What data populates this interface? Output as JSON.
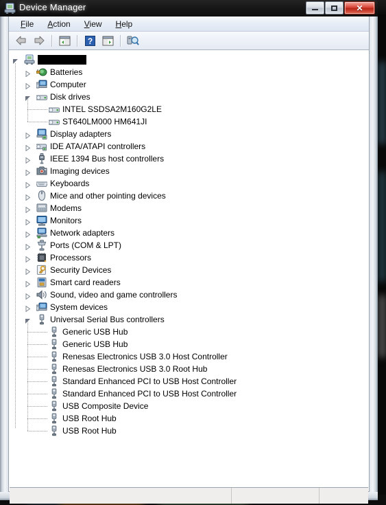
{
  "window": {
    "title": "Device Manager",
    "title_icon": "device-manager-icon",
    "caption_buttons": [
      {
        "name": "minimize-button",
        "glyph": "minimize"
      },
      {
        "name": "maximize-button",
        "glyph": "maximize"
      },
      {
        "name": "close-button",
        "glyph": "x"
      }
    ]
  },
  "menu": {
    "items": [
      {
        "name": "menu-file",
        "accel": "F",
        "rest": "ile"
      },
      {
        "name": "menu-action",
        "accel": "A",
        "rest": "ction"
      },
      {
        "name": "menu-view",
        "accel": "V",
        "rest": "iew"
      },
      {
        "name": "menu-help",
        "accel": "H",
        "rest": "elp"
      }
    ]
  },
  "toolbar": {
    "buttons": [
      {
        "name": "back-button",
        "icon": "back-arrow-icon"
      },
      {
        "name": "forward-button",
        "icon": "forward-arrow-icon"
      },
      {
        "name": "separator-1",
        "icon": "separator"
      },
      {
        "name": "show-hide-tree-button",
        "icon": "console-tree-icon"
      },
      {
        "name": "separator-2",
        "icon": "separator"
      },
      {
        "name": "help-button",
        "icon": "question-mark-icon"
      },
      {
        "name": "properties-button",
        "icon": "properties-icon"
      },
      {
        "name": "separator-3",
        "icon": "separator"
      },
      {
        "name": "scan-hardware-changes-button",
        "icon": "scan-hardware-icon"
      }
    ]
  },
  "tree": {
    "root": {
      "label": "",
      "label_redacted": true,
      "icon": "computer-root-icon",
      "expanded": true
    },
    "nodes": [
      {
        "label": "Batteries",
        "icon": "battery-icon",
        "level": 1,
        "expanded": false,
        "has_children": true
      },
      {
        "label": "Computer",
        "icon": "computer-icon",
        "level": 1,
        "expanded": false,
        "has_children": true
      },
      {
        "label": "Disk drives",
        "icon": "disk-drive-icon",
        "level": 1,
        "expanded": true,
        "has_children": true
      },
      {
        "label": "INTEL SSDSA2M160G2LE",
        "icon": "disk-drive-icon",
        "level": 2,
        "expanded": false,
        "has_children": false
      },
      {
        "label": "ST640LM000 HM641JI",
        "icon": "disk-drive-icon",
        "level": 2,
        "expanded": false,
        "has_children": false
      },
      {
        "label": "Display adapters",
        "icon": "display-adapter-icon",
        "level": 1,
        "expanded": false,
        "has_children": true
      },
      {
        "label": "IDE ATA/ATAPI controllers",
        "icon": "ide-controller-icon",
        "level": 1,
        "expanded": false,
        "has_children": true
      },
      {
        "label": "IEEE 1394 Bus host controllers",
        "icon": "firewire-icon",
        "level": 1,
        "expanded": false,
        "has_children": true
      },
      {
        "label": "Imaging devices",
        "icon": "camera-icon",
        "level": 1,
        "expanded": false,
        "has_children": true
      },
      {
        "label": "Keyboards",
        "icon": "keyboard-icon",
        "level": 1,
        "expanded": false,
        "has_children": true
      },
      {
        "label": "Mice and other pointing devices",
        "icon": "mouse-icon",
        "level": 1,
        "expanded": false,
        "has_children": true
      },
      {
        "label": "Modems",
        "icon": "modem-icon",
        "level": 1,
        "expanded": false,
        "has_children": true
      },
      {
        "label": "Monitors",
        "icon": "monitor-icon",
        "level": 1,
        "expanded": false,
        "has_children": true
      },
      {
        "label": "Network adapters",
        "icon": "network-adapter-icon",
        "level": 1,
        "expanded": false,
        "has_children": true
      },
      {
        "label": "Ports (COM & LPT)",
        "icon": "port-icon",
        "level": 1,
        "expanded": false,
        "has_children": true
      },
      {
        "label": "Processors",
        "icon": "processor-icon",
        "level": 1,
        "expanded": false,
        "has_children": true
      },
      {
        "label": "Security Devices",
        "icon": "security-key-icon",
        "level": 1,
        "expanded": false,
        "has_children": true
      },
      {
        "label": "Smart card readers",
        "icon": "smart-card-icon",
        "level": 1,
        "expanded": false,
        "has_children": true
      },
      {
        "label": "Sound, video and game controllers",
        "icon": "speaker-icon",
        "level": 1,
        "expanded": false,
        "has_children": true
      },
      {
        "label": "System devices",
        "icon": "system-device-icon",
        "level": 1,
        "expanded": false,
        "has_children": true
      },
      {
        "label": "Universal Serial Bus controllers",
        "icon": "usb-icon",
        "level": 1,
        "expanded": true,
        "has_children": true
      },
      {
        "label": "Generic USB Hub",
        "icon": "usb-icon",
        "level": 2,
        "expanded": false,
        "has_children": false
      },
      {
        "label": "Generic USB Hub",
        "icon": "usb-icon",
        "level": 2,
        "expanded": false,
        "has_children": false
      },
      {
        "label": "Renesas Electronics USB 3.0 Host Controller",
        "icon": "usb-icon",
        "level": 2,
        "expanded": false,
        "has_children": false
      },
      {
        "label": "Renesas Electronics USB 3.0 Root Hub",
        "icon": "usb-icon",
        "level": 2,
        "expanded": false,
        "has_children": false
      },
      {
        "label": "Standard Enhanced PCI to USB Host Controller",
        "icon": "usb-icon",
        "level": 2,
        "expanded": false,
        "has_children": false
      },
      {
        "label": "Standard Enhanced PCI to USB Host Controller",
        "icon": "usb-icon",
        "level": 2,
        "expanded": false,
        "has_children": false
      },
      {
        "label": "USB Composite Device",
        "icon": "usb-icon",
        "level": 2,
        "expanded": false,
        "has_children": false
      },
      {
        "label": "USB Root Hub",
        "icon": "usb-icon",
        "level": 2,
        "expanded": false,
        "has_children": false
      },
      {
        "label": "USB Root Hub",
        "icon": "usb-icon",
        "level": 2,
        "expanded": false,
        "has_children": false
      }
    ]
  },
  "statusbar": {
    "pane1": "",
    "pane2": "",
    "pane3": ""
  },
  "colors": {
    "titlebar": "#151515",
    "close_button": "#c0392b",
    "menubar": "#e7edf6",
    "tree_background": "#ffffff",
    "statusbar": "#f0eeec",
    "selection": "#cde0f7"
  }
}
